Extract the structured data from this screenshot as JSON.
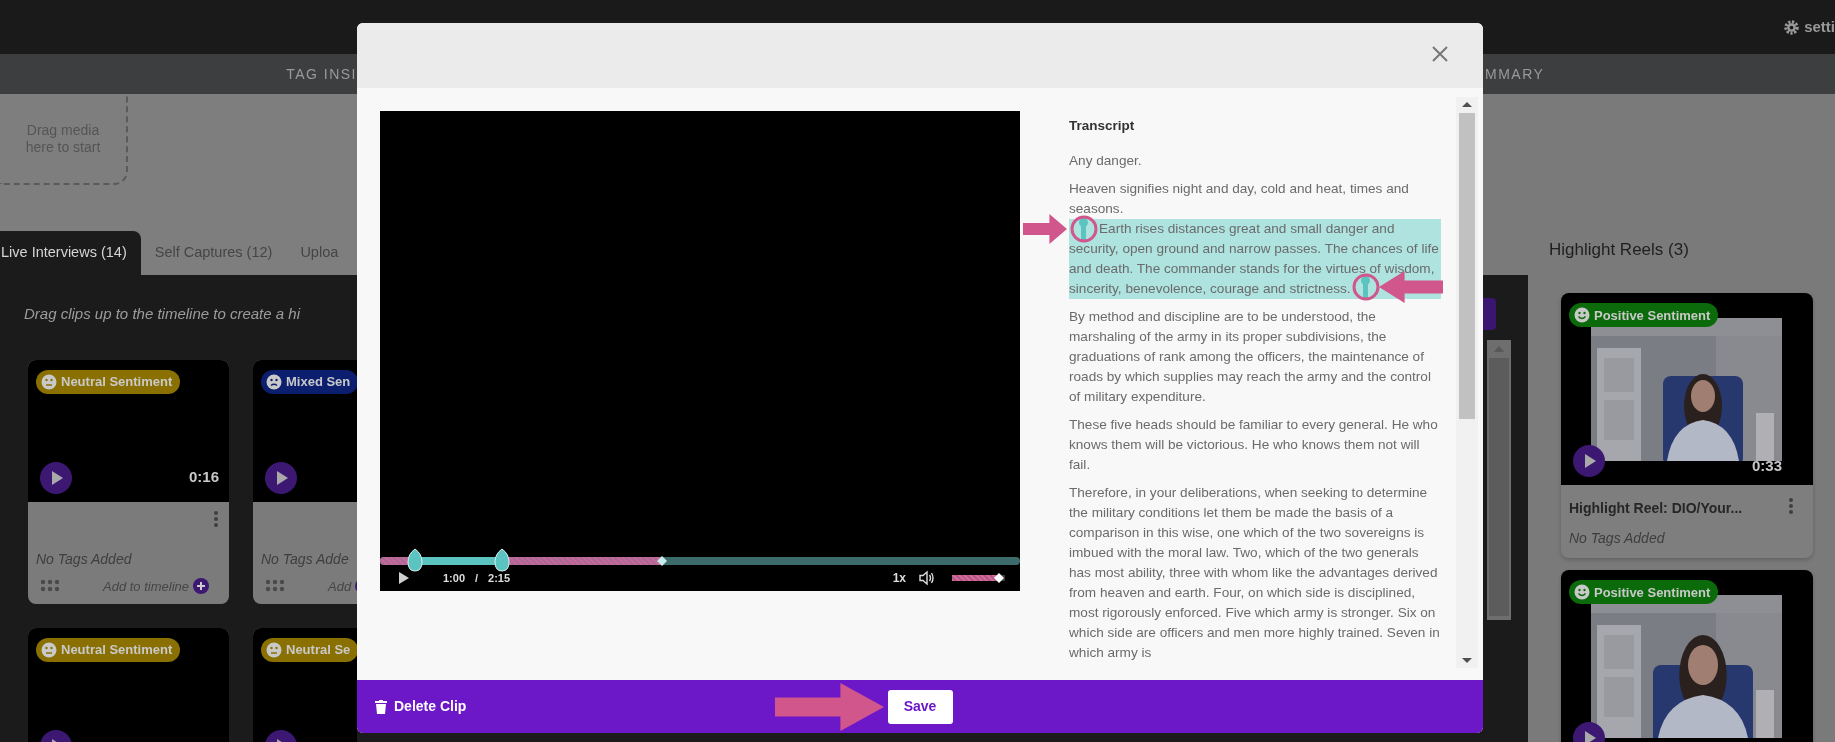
{
  "top_bar": {
    "settings_label": "setti"
  },
  "sub_nav": {
    "left_item": "TAG INSI",
    "right_item": "MMARY"
  },
  "drop_zone": {
    "text": "Drag media here to start"
  },
  "source_tabs": [
    {
      "label": "Live Interviews (14)",
      "selected": true
    },
    {
      "label": "Self Captures (12)",
      "selected": false
    },
    {
      "label": "Uploa",
      "selected": false
    }
  ],
  "hint": "Drag clips up to the timeline to create a hi",
  "clips": [
    {
      "kind": "neutral",
      "sentiment": "Neutral Sentiment",
      "color": "#8a7000",
      "duration": "0:16",
      "tags": "No Tags Added",
      "action": "Add to timeline"
    },
    {
      "kind": "mixed",
      "sentiment": "Mixed Sen",
      "color": "#0c1f6e",
      "tags": "No Tags Adde",
      "action": "Add"
    },
    {
      "kind": "neutral",
      "sentiment": "Neutral Sentiment",
      "color": "#8a7000"
    },
    {
      "kind": "neutral",
      "sentiment": "Neutral Se",
      "color": "#8a7000"
    }
  ],
  "highlight_reels": {
    "title": "Highlight Reels (3)",
    "items": [
      {
        "kind": "positive",
        "sentiment": "Positive Sentiment",
        "color": "#0b6b0b",
        "duration": "0:33",
        "title": "Highlight Reel: DIO/Your...",
        "tags": "No Tags Added"
      },
      {
        "kind": "positive",
        "sentiment": "Positive Sentiment",
        "color": "#0b6b0b"
      }
    ]
  },
  "clip_editor": {
    "player": {
      "progress": {
        "level": 0.44
      },
      "clip_start": {
        "level": 0.055
      },
      "clip_end": {
        "level": 0.19
      },
      "current_time": "1:00",
      "separator": "/",
      "total_time": "2:15",
      "speed": "1x",
      "volume": {
        "level": 0.88
      }
    },
    "transcript": {
      "title": "Transcript",
      "paragraphs": [
        {
          "segments": [
            {
              "text": "Any danger.",
              "highlighted": false
            }
          ]
        },
        {
          "segments": [
            {
              "text": "Heaven signifies night and day, cold and heat, times and seasons. ",
              "highlighted": false
            },
            {
              "text": "Earth rises distances great and small danger and security, open ground and narrow passes. The chances of life and death. The commander stands for the virtues of wisdom, sincerity, benevolence, courage and strictness.",
              "highlighted": true
            }
          ]
        },
        {
          "segments": [
            {
              "text": "By method and discipline are to be understood, the marshaling of the army in its proper subdivisions, the graduations of rank among the officers, the maintenance of roads by which supplies may reach the army and the control of military expenditure.",
              "highlighted": false
            }
          ]
        },
        {
          "segments": [
            {
              "text": "These five heads should be familiar to every general. He who knows them will be victorious. He who knows them not will fail.",
              "highlighted": false
            }
          ]
        },
        {
          "segments": [
            {
              "text": "Therefore, in your deliberations, when seeking to determine the military conditions let them be made the basis of a comparison in this wise, one which of the two sovereigns is imbued with the moral law. Two, which of the two generals has most ability, three with whom like the advantages derived from heaven and earth. Four, on which side is disciplined, most rigorously enforced. Five which army is stronger. Six on which side are officers and men more highly trained. Seven in which army is",
              "highlighted": false
            }
          ]
        }
      ]
    },
    "footer": {
      "delete_label": "Delete Clip",
      "save_label": "Save"
    }
  }
}
